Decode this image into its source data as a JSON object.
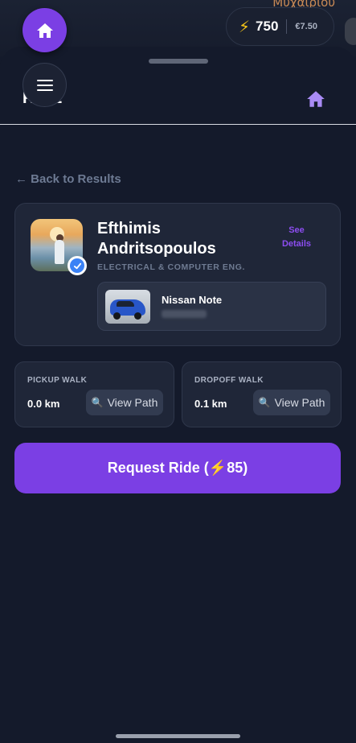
{
  "map": {
    "label": "Μυχαιρίου"
  },
  "credits": {
    "bolt_icon": "⚡",
    "amount": "750",
    "euro": "€7.50"
  },
  "header": {
    "title": "RIDE",
    "home_icon": "home-icon"
  },
  "back_link": "← Back to Results",
  "driver": {
    "name": "Efthimis Andritsopoulos",
    "department": "ELECTRICAL & COMPUTER ENG.",
    "see_details": "See Details",
    "verified": true,
    "car": {
      "model": "Nissan Note"
    }
  },
  "walks": {
    "pickup": {
      "label": "PICKUP WALK",
      "value": "0.0 km",
      "button": "View Path"
    },
    "dropoff": {
      "label": "DROPOFF WALK",
      "value": "0.1 km",
      "button": "View Path"
    }
  },
  "request_button": "Request Ride (⚡85)",
  "colors": {
    "accent": "#7b3fe4",
    "background": "#141a2b",
    "card": "#1f2638",
    "bolt": "#f5c518"
  }
}
